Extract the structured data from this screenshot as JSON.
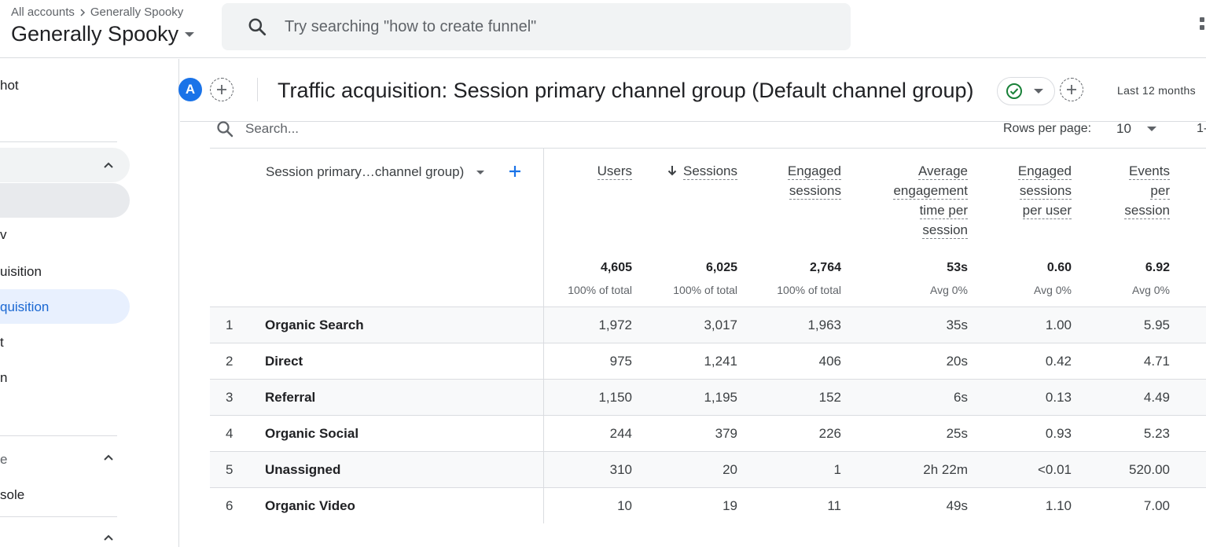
{
  "header": {
    "breadcrumb": {
      "root": "All accounts",
      "account": "Generally Spooky"
    },
    "account_title": "Generally Spooky",
    "search_placeholder": "Try searching \"how to create funnel\""
  },
  "sidebar": {
    "items": [
      {
        "label": "hot"
      },
      {
        "label": ""
      },
      {
        "label": "v"
      },
      {
        "label": "uisition"
      },
      {
        "label": "quisition"
      },
      {
        "label": "t"
      },
      {
        "label": "n"
      },
      {
        "label": "e"
      },
      {
        "label": "sole"
      }
    ]
  },
  "report": {
    "avatar_letter": "A",
    "title": "Traffic acquisition: Session primary channel group (Default channel group)",
    "date_range": "Last 12 months",
    "colors": {
      "accent": "#1a73e8",
      "ok": "#188038"
    }
  },
  "table": {
    "search_placeholder": "Search...",
    "rows_per_page_label": "Rows per page:",
    "rows_per_page_value": "10",
    "pager": "1-",
    "dimension_header": "Session primary…channel group)",
    "columns": [
      {
        "label_lines": [
          "Users"
        ],
        "total": "4,605",
        "total_sub": "100% of total"
      },
      {
        "label_lines": [
          "Sessions"
        ],
        "total": "6,025",
        "total_sub": "100% of total",
        "sorted": true
      },
      {
        "label_lines": [
          "Engaged",
          "sessions"
        ],
        "total": "2,764",
        "total_sub": "100% of total"
      },
      {
        "label_lines": [
          "Average",
          "engagement",
          "time per",
          "session"
        ],
        "total": "53s",
        "total_sub": "Avg 0%"
      },
      {
        "label_lines": [
          "Engaged",
          "sessions",
          "per user"
        ],
        "total": "0.60",
        "total_sub": "Avg 0%"
      },
      {
        "label_lines": [
          "Events",
          "per",
          "session"
        ],
        "total": "6.92",
        "total_sub": "Avg 0%"
      }
    ],
    "rows": [
      {
        "num": "1",
        "name": "Organic Search",
        "values": [
          "1,972",
          "3,017",
          "1,963",
          "35s",
          "1.00",
          "5.95"
        ]
      },
      {
        "num": "2",
        "name": "Direct",
        "values": [
          "975",
          "1,241",
          "406",
          "20s",
          "0.42",
          "4.71"
        ]
      },
      {
        "num": "3",
        "name": "Referral",
        "values": [
          "1,150",
          "1,195",
          "152",
          "6s",
          "0.13",
          "4.49"
        ]
      },
      {
        "num": "4",
        "name": "Organic Social",
        "values": [
          "244",
          "379",
          "226",
          "25s",
          "0.93",
          "5.23"
        ]
      },
      {
        "num": "5",
        "name": "Unassigned",
        "values": [
          "310",
          "20",
          "1",
          "2h 22m",
          "<0.01",
          "520.00"
        ]
      },
      {
        "num": "6",
        "name": "Organic Video",
        "values": [
          "10",
          "19",
          "11",
          "49s",
          "1.10",
          "7.00"
        ]
      }
    ]
  }
}
